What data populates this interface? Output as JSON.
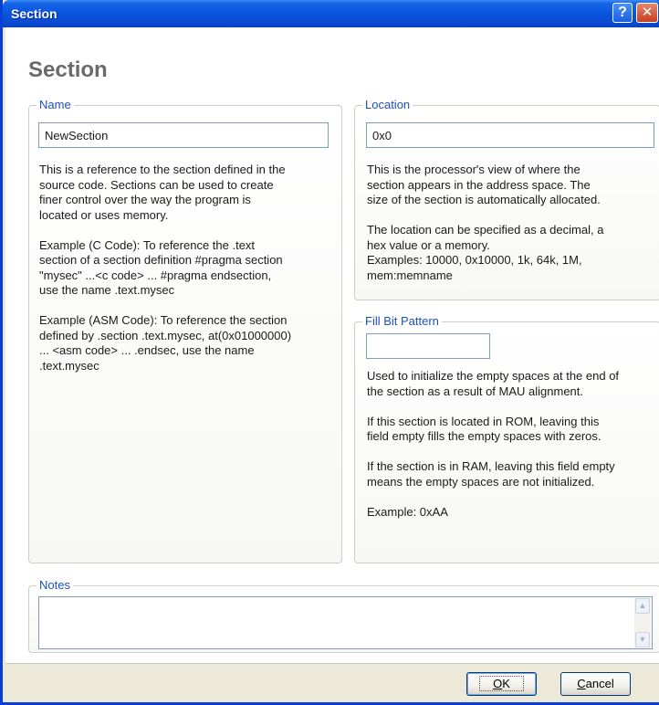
{
  "window": {
    "title": "Section",
    "help_glyph": "?",
    "close_glyph": "✕"
  },
  "page": {
    "heading": "Section"
  },
  "name_group": {
    "legend": "Name",
    "value": "NewSection",
    "description": "This is a reference to the section defined in the\nsource code. Sections can be used to create\nfiner control over the way the program is\nlocated or uses memory.\n\nExample (C Code): To reference the .text\nsection of a section definition #pragma section\n\"mysec\" ...<c code> ... #pragma endsection,\nuse the name .text.mysec\n\nExample (ASM Code): To reference the section\ndefined by .section .text.mysec, at(0x01000000)\n... <asm code> ... .endsec, use the name\n.text.mysec"
  },
  "location_group": {
    "legend": "Location",
    "value": "0x0",
    "description": "This is the processor's view of where the\nsection appears in the address space. The\nsize of the section is automatically allocated.\n\nThe location can be specified as a decimal, a\nhex value or a memory.\nExamples: 10000, 0x10000, 1k, 64k, 1M,\nmem:memname"
  },
  "fill_group": {
    "legend": "Fill Bit Pattern",
    "value": "",
    "description": "Used to initialize the empty spaces at the end of\nthe section as a result of MAU alignment.\n\nIf this section is located in ROM, leaving this\nfield empty fills the empty spaces with zeros.\n\nIf the section is in RAM, leaving this field empty\nmeans the empty spaces are not initialized.\n\nExample: 0xAA"
  },
  "notes_group": {
    "legend": "Notes",
    "value": ""
  },
  "buttons": {
    "ok_label": "OK",
    "ok_mnemonic": "O",
    "ok_rest": "K",
    "cancel_label": "Cancel",
    "cancel_mnemonic": "C",
    "cancel_rest": "ancel"
  },
  "colors": {
    "title_bar": "#0a54dc",
    "legend_text": "#1e4fbd",
    "heading_text": "#6a6a6a",
    "dialog_face": "#ece9d8"
  }
}
